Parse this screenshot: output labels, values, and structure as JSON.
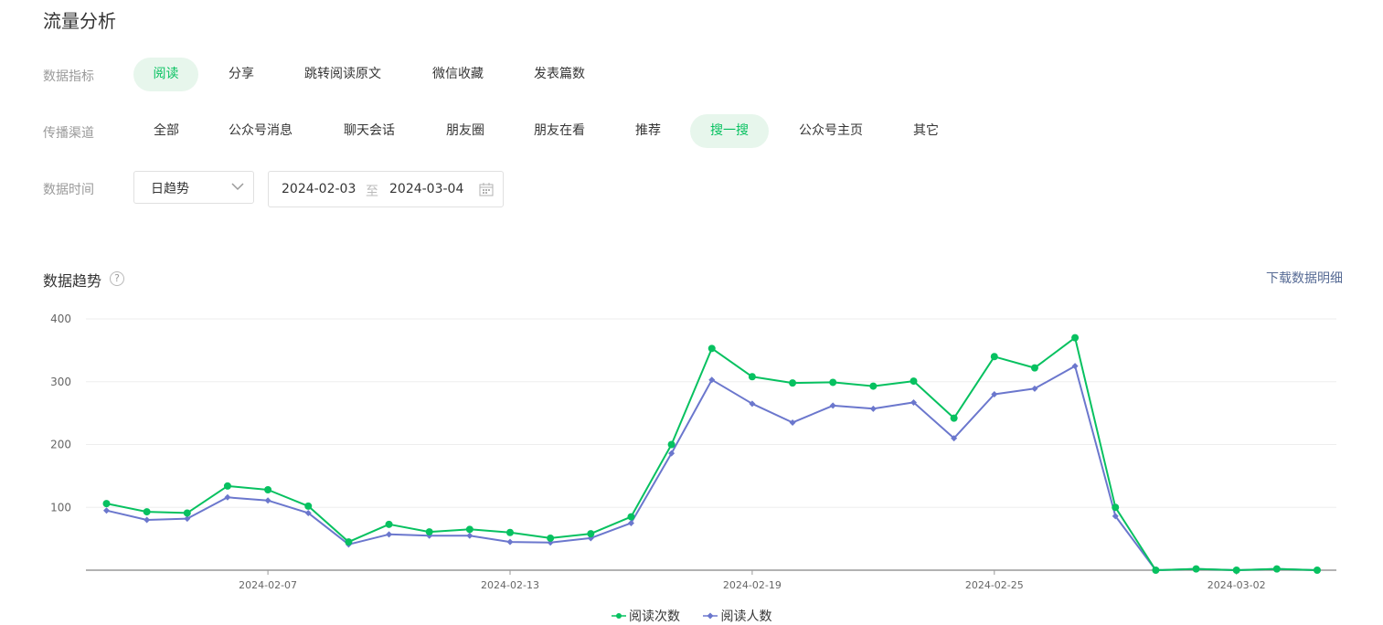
{
  "page": {
    "title": "流量分析"
  },
  "filters": {
    "metric": {
      "label": "数据指标",
      "options": [
        "阅读",
        "分享",
        "跳转阅读原文",
        "微信收藏",
        "发表篇数"
      ],
      "active": 0
    },
    "channel": {
      "label": "传播渠道",
      "options": [
        "全部",
        "公众号消息",
        "聊天会话",
        "朋友圈",
        "朋友在看",
        "推荐",
        "搜一搜",
        "公众号主页",
        "其它"
      ],
      "active": 6
    },
    "time": {
      "label": "数据时间",
      "granularity": "日趋势",
      "start_date": "2024-02-03",
      "range_sep": "至",
      "end_date": "2024-03-04"
    }
  },
  "trend": {
    "title": "数据趋势",
    "help": "?",
    "download_label": "下载数据明细"
  },
  "colors": {
    "accent": "#07c160",
    "series1": "#07c160",
    "series2": "#6b77cd",
    "link": "#576b95"
  },
  "chart_data": {
    "type": "line",
    "x": [
      "2024-02-03",
      "2024-02-04",
      "2024-02-05",
      "2024-02-06",
      "2024-02-07",
      "2024-02-08",
      "2024-02-09",
      "2024-02-10",
      "2024-02-11",
      "2024-02-12",
      "2024-02-13",
      "2024-02-14",
      "2024-02-15",
      "2024-02-16",
      "2024-02-17",
      "2024-02-18",
      "2024-02-19",
      "2024-02-20",
      "2024-02-21",
      "2024-02-22",
      "2024-02-23",
      "2024-02-24",
      "2024-02-25",
      "2024-02-26",
      "2024-02-27",
      "2024-02-28",
      "2024-02-29",
      "2024-03-01",
      "2024-03-02",
      "2024-03-03",
      "2024-03-04"
    ],
    "xticks": [
      "2024-02-07",
      "2024-02-13",
      "2024-02-19",
      "2024-02-25",
      "2024-03-02"
    ],
    "yticks": [
      100,
      200,
      300,
      400
    ],
    "ylim": [
      0,
      400
    ],
    "series": [
      {
        "name": "阅读次数",
        "marker": "circle",
        "values": [
          106,
          93,
          91,
          134,
          128,
          102,
          45,
          73,
          61,
          65,
          60,
          51,
          58,
          85,
          200,
          353,
          308,
          298,
          299,
          293,
          301,
          242,
          340,
          322,
          370,
          100,
          0,
          2,
          0,
          2,
          0
        ]
      },
      {
        "name": "阅读人数",
        "marker": "diamond",
        "values": [
          95,
          80,
          82,
          116,
          111,
          91,
          41,
          57,
          55,
          55,
          45,
          44,
          51,
          75,
          186,
          303,
          265,
          235,
          262,
          257,
          267,
          210,
          280,
          289,
          325,
          86,
          0,
          2,
          0,
          2,
          0
        ]
      }
    ],
    "legend_position": "bottom",
    "grid": true
  }
}
